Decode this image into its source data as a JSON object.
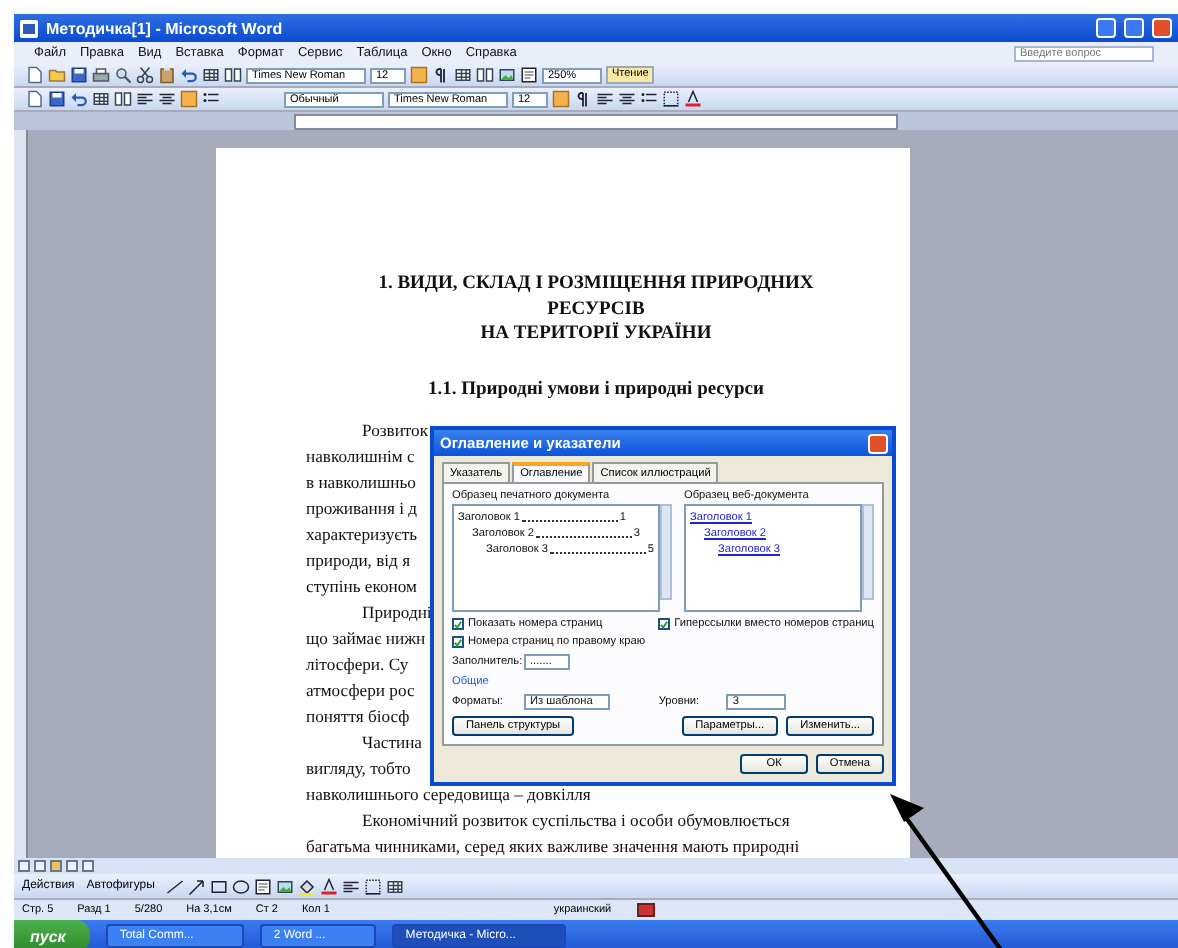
{
  "window": {
    "title": "Методичка[1] - Microsoft Word",
    "help_placeholder": "Введите вопрос"
  },
  "menu": [
    "Файл",
    "Правка",
    "Вид",
    "Вставка",
    "Формат",
    "Сервис",
    "Таблица",
    "Окно",
    "Справка"
  ],
  "toolbar_standard": {
    "font": "Times New Roman",
    "size": "12",
    "zoom": "250%",
    "read_button": "Чтение"
  },
  "toolbar_format": {
    "style": "Обычный",
    "font": "Times New Roman",
    "size": "12"
  },
  "document": {
    "heading_lines": [
      "1. ВИДИ, СКЛАД І РОЗМІЩЕННЯ ПРИРОДНИХ",
      "РЕСУРСІВ",
      "НА ТЕРИТОРІЇ УКРАЇНИ"
    ],
    "subheading": "1.1. Природні умови і природні ресурси",
    "lines": [
      {
        "text": "Розвиток",
        "indent": true
      },
      {
        "text": "навколишнім с",
        "indent": false
      },
      {
        "text": "в навколишньо",
        "indent": false
      },
      {
        "text": "проживання і д",
        "indent": false
      },
      {
        "text": "характеризуєть",
        "indent": false
      },
      {
        "text": "природи, від я",
        "indent": false
      },
      {
        "text": "ступінь економ",
        "indent": false
      },
      {
        "text": "Природні",
        "indent": true
      },
      {
        "text": "що займає нижн",
        "indent": false
      },
      {
        "text": "літосфери. Су",
        "indent": false
      },
      {
        "text": "атмосфери рос",
        "indent": false
      },
      {
        "text": "поняття біосф",
        "indent": false
      },
      {
        "text": "Частина",
        "indent": true
      },
      {
        "text": "вигляду, тобто",
        "indent": false
      },
      {
        "text": "навколишнього середовища – довкілля",
        "indent": false
      },
      {
        "text": "Економічний розвиток суспільства і особи обумовлюється",
        "indent": true
      },
      {
        "text": "багатьма чинниками, серед яких важливе значення мають природні",
        "indent": false
      }
    ]
  },
  "dialog": {
    "title": "Оглавление и указатели",
    "tabs": [
      {
        "label": "Указатель",
        "selected": false
      },
      {
        "label": "Оглавление",
        "selected": true
      },
      {
        "label": "Список иллюстраций",
        "selected": false
      }
    ],
    "print_preview": {
      "label": "Образец печатного документа",
      "entries": [
        {
          "text": "Заголовок 1",
          "page": "1",
          "children": [
            {
              "text": "Заголовок 2",
              "page": "3",
              "children": [
                {
                  "text": "Заголовок 3",
                  "page": "5"
                }
              ]
            }
          ]
        }
      ]
    },
    "web_preview": {
      "label": "Образец веб-документа",
      "entries": [
        {
          "text": "Заголовок 1",
          "children": [
            {
              "text": "Заголовок 2",
              "children": [
                {
                  "text": "Заголовок 3"
                }
              ]
            }
          ]
        }
      ]
    },
    "checkboxes": [
      {
        "label": "Показать номера страниц",
        "checked": true
      },
      {
        "label": "Гиперссылки вместо номеров страниц",
        "checked": true
      },
      {
        "label": "Номера страниц по правому краю",
        "checked": true
      }
    ],
    "leader": {
      "label": "Заполнитель:",
      "value": "......."
    },
    "general_label": "Общие",
    "formats": {
      "label": "Форматы:",
      "value": "Из шаблона"
    },
    "levels": {
      "label": "Уровни:",
      "value": "3"
    },
    "outline_button": "Панель структуры",
    "options_button": "Параметры...",
    "modify_button": "Изменить...",
    "ok_button": "ОК",
    "cancel_button": "Отмена"
  },
  "drawing_toolbar": {
    "actions": "Действия",
    "autoshapes": "Автофигуры"
  },
  "status_bar": [
    "Стр. 5",
    "Разд 1",
    "5/280",
    "На 3,1см",
    "Ст 2",
    "Кол 1"
  ],
  "language": "украинский",
  "taskbar": {
    "start": "пуск",
    "tasks": [
      {
        "label": "Total Comm...",
        "selected": false
      },
      {
        "label": "2 Word ...",
        "selected": false
      },
      {
        "label": "Методичка - Micro...",
        "selected": true
      }
    ]
  }
}
